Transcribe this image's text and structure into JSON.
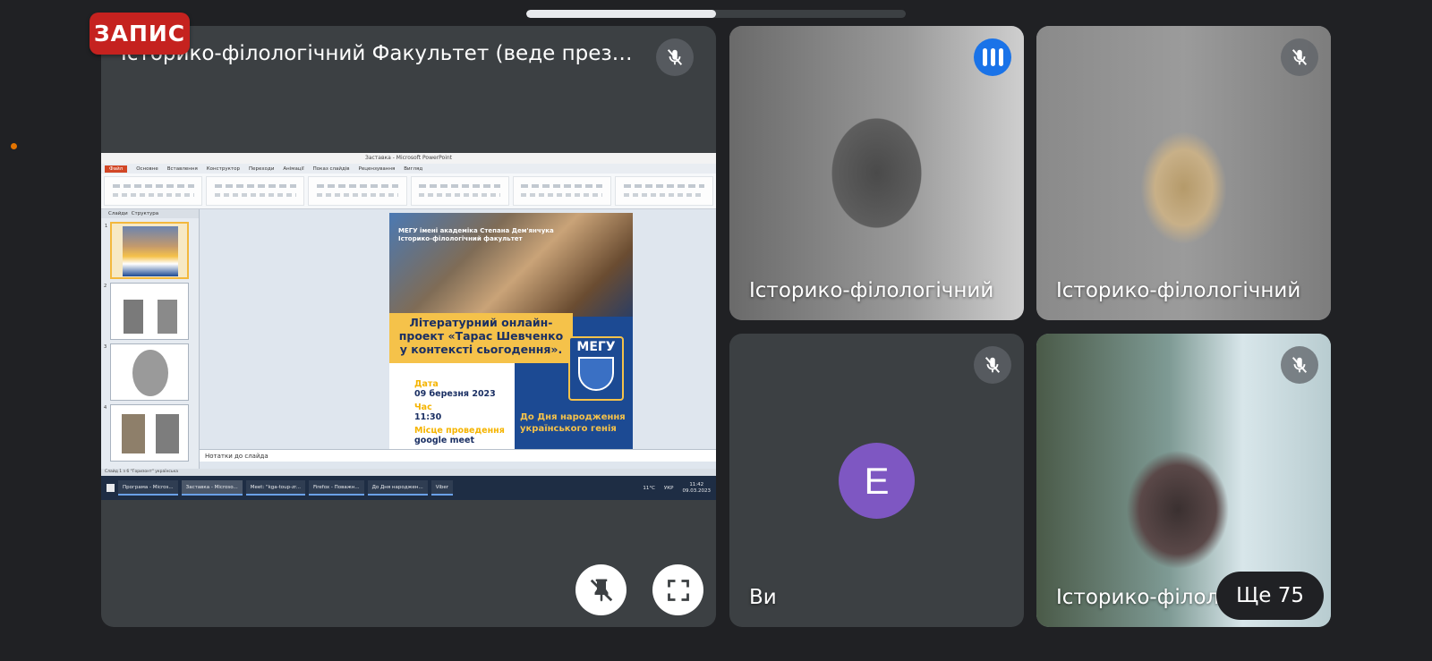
{
  "recording_badge": "ЗАПИС",
  "presentation": {
    "title": "Історико-філологічний Факультет (веде презе...",
    "screen": {
      "window_title": "Заставка - Microsoft PowerPoint",
      "tabs": [
        "Файл",
        "Основне",
        "Вставлення",
        "Конструктор",
        "Переходи",
        "Анімації",
        "Показ слайдів",
        "Рецензування",
        "Вигляд"
      ],
      "pane_tabs": [
        "Слайди",
        "Структура"
      ],
      "slide_numbers": [
        "1",
        "2",
        "3",
        "4"
      ],
      "slide": {
        "header_line1": "МЕГУ імені академіка Степана Дем'янчука",
        "header_line2": "Історико-філологічний факультет",
        "banner_line1": "Літературний онлайн-",
        "banner_line2": "проект «Тарас Шевченко",
        "banner_line3": "у контексті сьогодення».",
        "date_label": "Дата",
        "date_value": "09 березня 2023",
        "time_label": "Час",
        "time_value": "11:30",
        "place_label": "Місце проведення",
        "place_value": "google meet",
        "logo_text": "МЕГУ",
        "birthday_line1": "До Дня народження",
        "birthday_line2": "українського генія"
      },
      "notes_placeholder": "Нотатки до слайда",
      "status_text": "Слайд 1 з 6   \"Горизонт\"   українська",
      "taskbar": {
        "items": [
          "Програма - Micros...",
          "Заставка - Microso...",
          "Meet: \"kga-toup-zr...",
          "Firefox - Поважн...",
          "До Дня народжен...",
          "Viber"
        ],
        "weather": "11°C",
        "lang": "УКР",
        "time": "11:42",
        "date": "09.03.2023"
      }
    }
  },
  "participants": [
    {
      "name": "Історико-філологічний",
      "state": "speaking"
    },
    {
      "name": "Історико-філологічний",
      "state": "muted"
    },
    {
      "name": "Ви",
      "initial": "E",
      "avatar_color": "#7e57c2",
      "state": "muted"
    },
    {
      "name": "Історико-філол",
      "state": "muted"
    }
  ],
  "more_participants": "Ще 75",
  "progress": {
    "fraction": 0.5
  },
  "colors": {
    "background": "#202124",
    "tile": "#3c4043",
    "recording": "#c5221f",
    "speaking": "#1a73e8",
    "avatar": "#7e57c2"
  }
}
